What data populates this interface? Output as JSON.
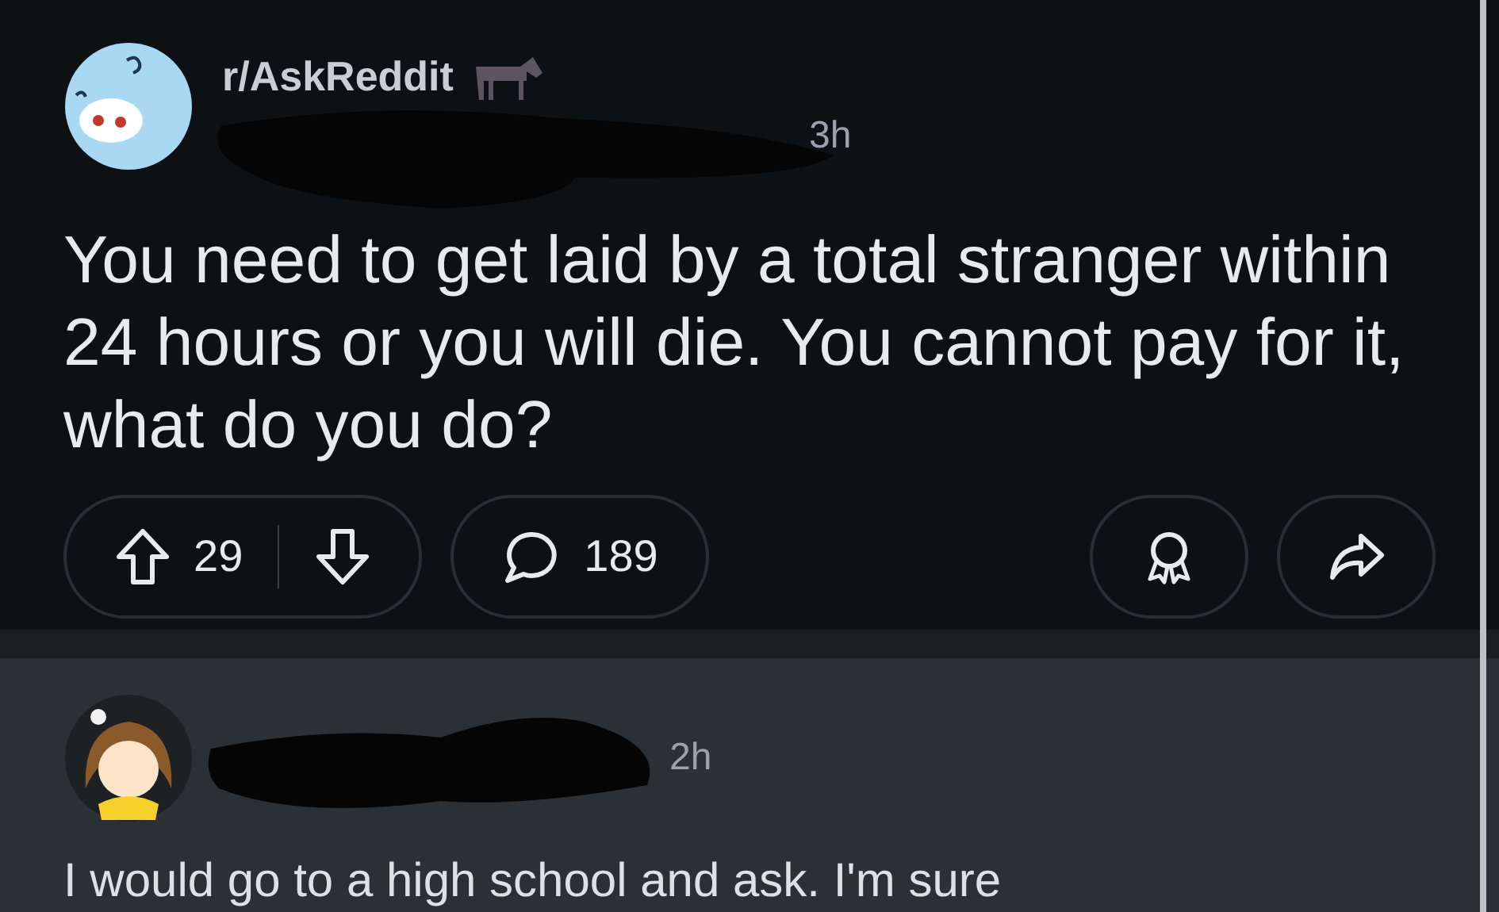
{
  "post": {
    "subreddit": "r/AskReddit",
    "time": "3h",
    "title": "You need to get laid by a total stranger within 24 hours or you will die. You cannot pay for it, what do you do?",
    "votes": "29",
    "comments": "189"
  },
  "comment": {
    "time": "2h",
    "text": "I would go to a high school and ask. I'm sure"
  }
}
